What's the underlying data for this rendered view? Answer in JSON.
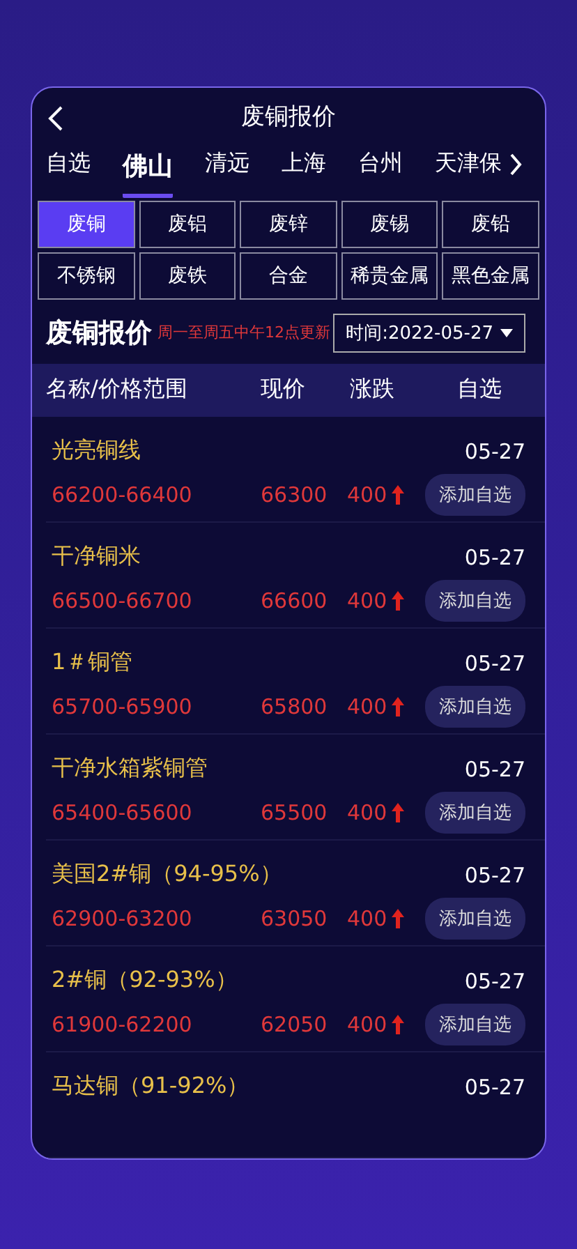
{
  "header": {
    "title": "废铜报价"
  },
  "tabs": [
    {
      "label": "自选",
      "selected": false
    },
    {
      "label": "佛山",
      "selected": true
    },
    {
      "label": "清远",
      "selected": false
    },
    {
      "label": "上海",
      "selected": false
    },
    {
      "label": "台州",
      "selected": false
    },
    {
      "label": "天津保",
      "selected": false
    }
  ],
  "categories": [
    {
      "label": "废铜",
      "selected": true
    },
    {
      "label": "废铝",
      "selected": false
    },
    {
      "label": "废锌",
      "selected": false
    },
    {
      "label": "废锡",
      "selected": false
    },
    {
      "label": "废铅",
      "selected": false
    },
    {
      "label": "不锈钢",
      "selected": false
    },
    {
      "label": "废铁",
      "selected": false
    },
    {
      "label": "合金",
      "selected": false
    },
    {
      "label": "稀贵金属",
      "selected": false
    },
    {
      "label": "黑色金属",
      "selected": false
    }
  ],
  "section": {
    "title": "废铜报价",
    "note": "周一至周五中午12点更新",
    "date_picker": "时间:2022-05-27"
  },
  "table": {
    "columns": [
      "名称/价格范围",
      "现价",
      "涨跌",
      "自选"
    ],
    "rows": [
      {
        "name": "光亮铜线",
        "range": "66200-66400",
        "price": "66300",
        "change": "400",
        "date": "05-27",
        "action": "添加自选"
      },
      {
        "name": "干净铜米",
        "range": "66500-66700",
        "price": "66600",
        "change": "400",
        "date": "05-27",
        "action": "添加自选"
      },
      {
        "name": "1＃铜管",
        "range": "65700-65900",
        "price": "65800",
        "change": "400",
        "date": "05-27",
        "action": "添加自选"
      },
      {
        "name": "干净水箱紫铜管",
        "range": "65400-65600",
        "price": "65500",
        "change": "400",
        "date": "05-27",
        "action": "添加自选"
      },
      {
        "name": "美国2#铜（94-95%）",
        "range": "62900-63200",
        "price": "63050",
        "change": "400",
        "date": "05-27",
        "action": "添加自选"
      },
      {
        "name": "2#铜（92-93%）",
        "range": "61900-62200",
        "price": "62050",
        "change": "400",
        "date": "05-27",
        "action": "添加自选"
      },
      {
        "name": "马达铜（91-92%）",
        "date": "05-27"
      }
    ]
  }
}
